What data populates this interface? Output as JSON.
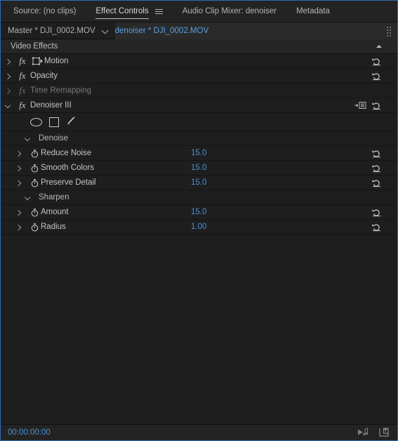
{
  "window": {
    "accent_blue": "#2b6bb5",
    "value_blue": "#4a8fd4",
    "bg": "#1e1e1e"
  },
  "tabs": [
    {
      "label": "Source: (no clips)",
      "active": false,
      "name": "tab-source"
    },
    {
      "label": "Effect Controls",
      "active": true,
      "name": "tab-effect-controls",
      "menu_icon": "hamburger-menu-icon"
    },
    {
      "label": "Audio Clip Mixer: denoiser",
      "active": false,
      "name": "tab-audio-clip-mixer"
    },
    {
      "label": "Metadata",
      "active": false,
      "name": "tab-metadata"
    }
  ],
  "clip_bar": {
    "master_clip": "Master * DJI_0002.MOV",
    "dropdown_icon": "chevron-down-icon",
    "sequence_clip": "denoiser * DJI_0002.MOV",
    "grip_icon": "drag-grip-icon"
  },
  "effects_panel": {
    "section_header": "Video Effects",
    "collapse_icon": "triangle-up-icon",
    "effects": [
      {
        "label": "Motion",
        "expanded": false,
        "disabled": false,
        "icon": "transform-icon",
        "reset_icon": "reset-icon",
        "name": "effect-motion"
      },
      {
        "label": "Opacity",
        "expanded": false,
        "disabled": false,
        "icon": "",
        "reset_icon": "reset-icon",
        "name": "effect-opacity"
      },
      {
        "label": "Time Remapping",
        "expanded": false,
        "disabled": true,
        "icon": "",
        "reset_icon": "",
        "name": "effect-time-remapping"
      },
      {
        "label": "Denoiser III",
        "expanded": true,
        "disabled": false,
        "icon": "",
        "reset_icon": "reset-icon",
        "mask_icon": "free-draw-mask-icon",
        "name": "effect-denoiser-iii"
      }
    ],
    "mask_tools": [
      {
        "name": "ellipse-mask-icon",
        "label": "Create ellipse mask"
      },
      {
        "name": "rectangle-mask-icon",
        "label": "Create 4-point polygon mask"
      },
      {
        "name": "pen-mask-icon",
        "label": "Free draw bezier"
      }
    ],
    "groups": [
      {
        "label": "Denoise",
        "expanded": true,
        "name": "group-denoise",
        "params": [
          {
            "label": "Reduce Noise",
            "value": "15.0",
            "name": "param-reduce-noise"
          },
          {
            "label": "Smooth Colors",
            "value": "15.0",
            "name": "param-smooth-colors"
          },
          {
            "label": "Preserve Detail",
            "value": "15.0",
            "name": "param-preserve-detail"
          }
        ]
      },
      {
        "label": "Sharpen",
        "expanded": true,
        "name": "group-sharpen",
        "params": [
          {
            "label": "Amount",
            "value": "15.0",
            "name": "param-amount"
          },
          {
            "label": "Radius",
            "value": "1.00",
            "name": "param-radius"
          }
        ]
      }
    ]
  },
  "footer": {
    "timecode": "00:00:00:00",
    "icons": [
      {
        "name": "play-audio-icon"
      },
      {
        "name": "export-frame-icon"
      }
    ]
  }
}
